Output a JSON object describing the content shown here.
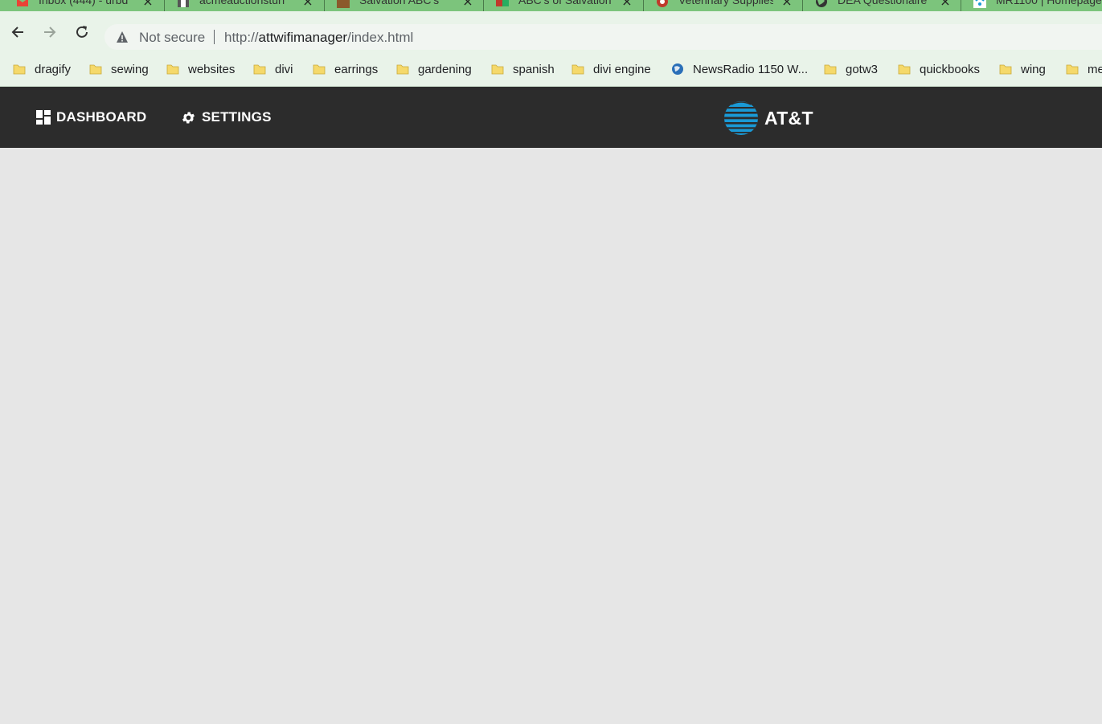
{
  "browser": {
    "tabs": [
      {
        "title": "Inbox (444) - urbd",
        "icon": "gmail-icon"
      },
      {
        "title": "acmeauctionsturf",
        "icon": "site-icon"
      },
      {
        "title": "Salvation ABC's",
        "icon": "sdf-icon"
      },
      {
        "title": "ABC's of Salvation",
        "icon": "site-icon"
      },
      {
        "title": "Veterinary Supplies",
        "icon": "site-icon"
      },
      {
        "title": "DEA Questionaire",
        "icon": "globe-icon"
      },
      {
        "title": "MR1100 | Homepage",
        "icon": "wifi-icon"
      }
    ],
    "address": {
      "security_label": "Not secure",
      "url_scheme": "http://",
      "url_host": "attwifimanager",
      "url_path": "/index.html"
    },
    "bookmarks": [
      {
        "label": "dragify",
        "icon": "folder-icon"
      },
      {
        "label": "sewing",
        "icon": "folder-icon"
      },
      {
        "label": "websites",
        "icon": "folder-icon"
      },
      {
        "label": "divi",
        "icon": "folder-icon"
      },
      {
        "label": "earrings",
        "icon": "folder-icon"
      },
      {
        "label": "gardening",
        "icon": "folder-icon"
      },
      {
        "label": "spanish",
        "icon": "folder-icon"
      },
      {
        "label": "divi engine",
        "icon": "folder-icon"
      },
      {
        "label": "NewsRadio 1150 W...",
        "icon": "globe-icon"
      },
      {
        "label": "gotw3",
        "icon": "folder-icon"
      },
      {
        "label": "quickbooks",
        "icon": "folder-icon"
      },
      {
        "label": "wing",
        "icon": "folder-icon"
      },
      {
        "label": "me",
        "icon": "folder-icon"
      }
    ]
  },
  "app": {
    "nav": {
      "dashboard_label": "DASHBOARD",
      "settings_label": "SETTINGS"
    },
    "logo_text": "AT&T"
  },
  "colors": {
    "tabstrip": "#7cc47c",
    "toolbar": "#e9f3e9",
    "appbar": "#2c2c2c",
    "page": "#e6e6e6",
    "att_blue": "#1a9ad6"
  }
}
